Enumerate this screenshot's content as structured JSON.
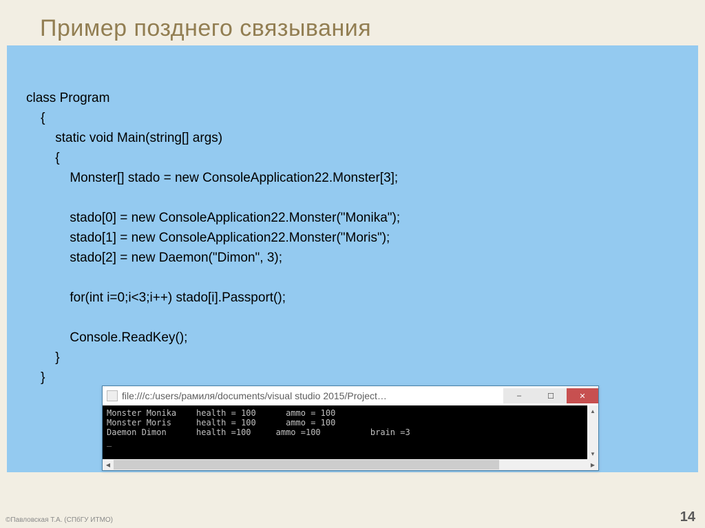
{
  "title": "Пример позднего связывания",
  "code": "class Program\n    {\n        static void Main(string[] args)\n        {\n            Monster[] stado = new ConsoleApplication22.Monster[3];\n\n            stado[0] = new ConsoleApplication22.Monster(\"Monika\");\n            stado[1] = new ConsoleApplication22.Monster(\"Moris\");\n            stado[2] = new Daemon(\"Dimon\", 3);\n\n            for(int i=0;i<3;i++) stado[i].Passport();\n\n            Console.ReadKey();\n        }\n    }",
  "console": {
    "path": "file:///c:/users/рамиля/documents/visual studio 2015/Project…",
    "output": "Monster Monika    health = 100      ammo = 100\nMonster Moris     health = 100      ammo = 100\nDaemon Dimon      health =100     ammo =100          brain =3\n_",
    "buttons": {
      "min": "‒",
      "max": "☐",
      "close": "✕"
    }
  },
  "footer": "©Павловская Т.А. (СПбГУ ИТМО)",
  "page_number": "14"
}
